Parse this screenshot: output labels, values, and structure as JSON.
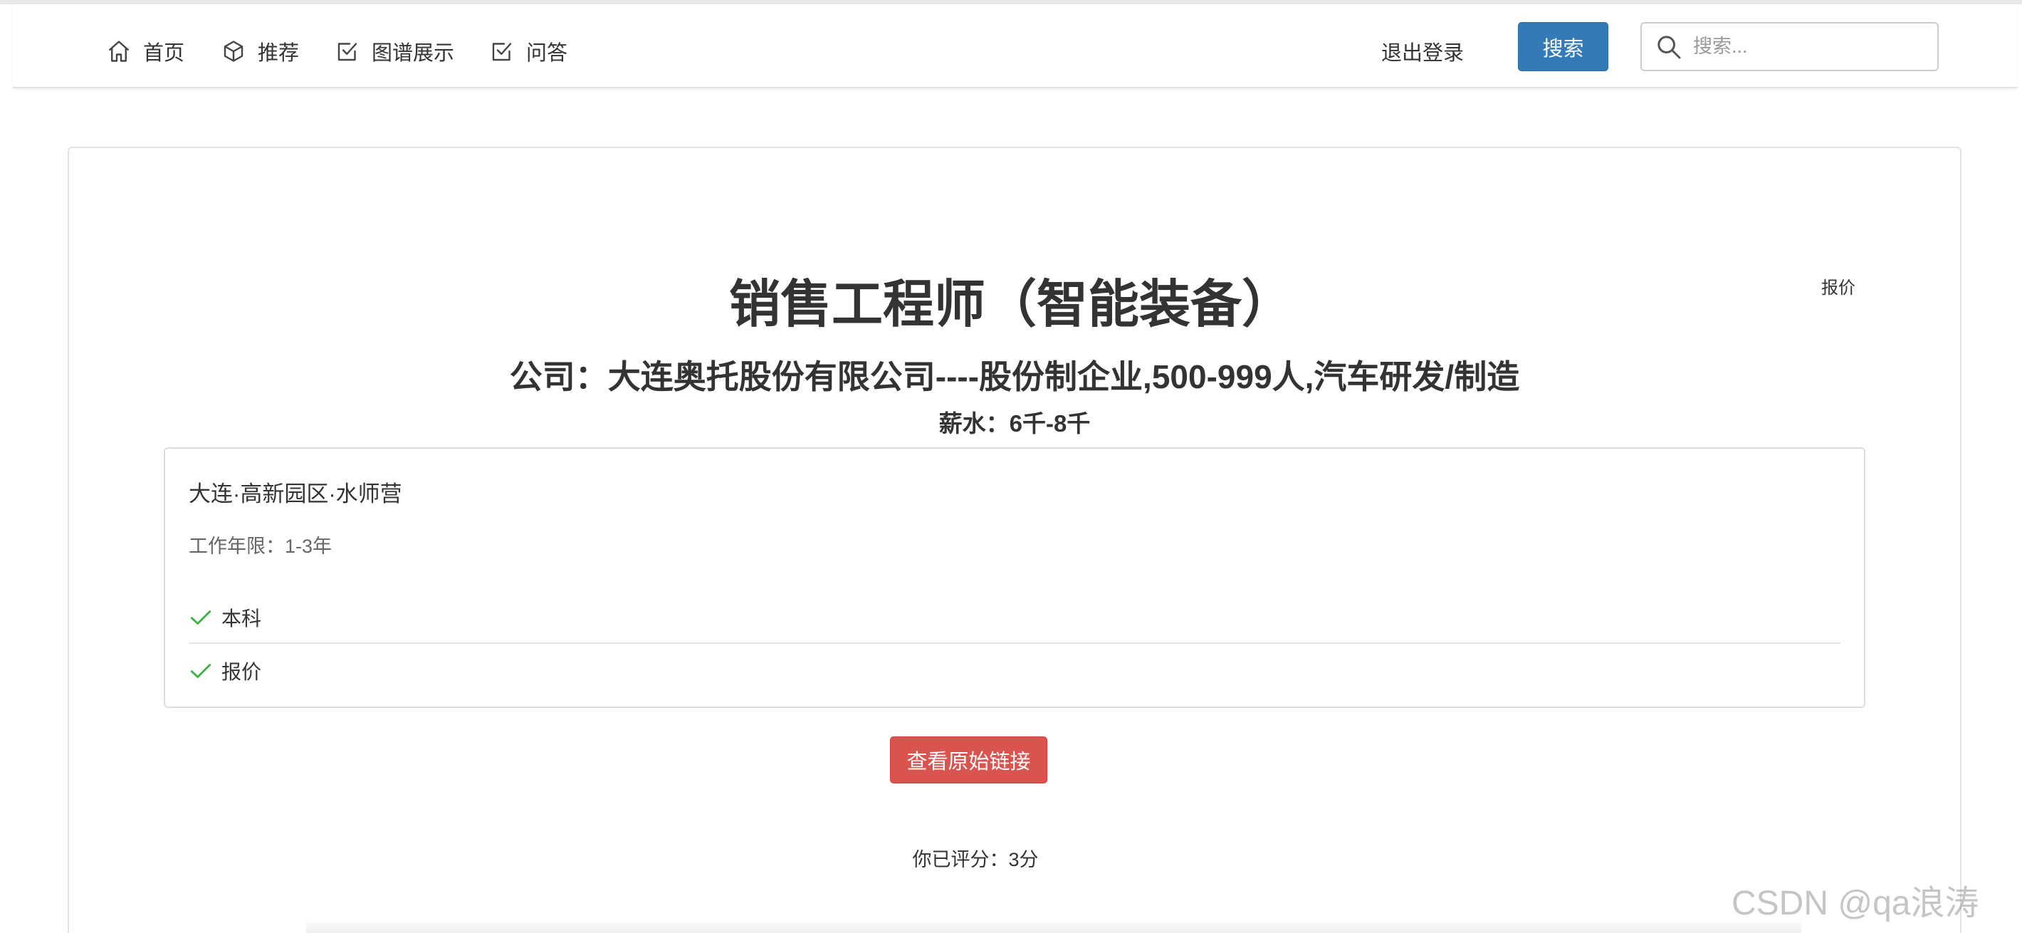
{
  "nav": {
    "items": [
      {
        "label": "首页",
        "icon": "home-icon"
      },
      {
        "label": "推荐",
        "icon": "cube-icon"
      },
      {
        "label": "图谱展示",
        "icon": "checkbox-icon"
      },
      {
        "label": "问答",
        "icon": "checkbox-icon"
      }
    ],
    "logout_label": "退出登录",
    "search_button_label": "搜索",
    "search_placeholder": "搜索...",
    "search_value": ""
  },
  "job": {
    "title": "销售工程师（智能装备）",
    "quote_link_label": "报价",
    "company_line": "公司：大连奥托股份有限公司----股份制企业,500-999人,汽车研发/制造",
    "salary_line": "薪水：6千-8千",
    "location": "大连·高新园区·水师营",
    "experience": "工作年限：1-3年",
    "requirements": [
      {
        "label": "本科",
        "icon": "check-icon"
      },
      {
        "label": "报价",
        "icon": "check-icon"
      }
    ],
    "original_link_button_label": "查看原始链接",
    "rating_text": "你已评分：3分"
  },
  "watermark": "CSDN @qa浪涛",
  "colors": {
    "primary_button": "#337ab7",
    "danger_button": "#d9534f",
    "check_icon": "#3cb043",
    "text": "#333333"
  }
}
